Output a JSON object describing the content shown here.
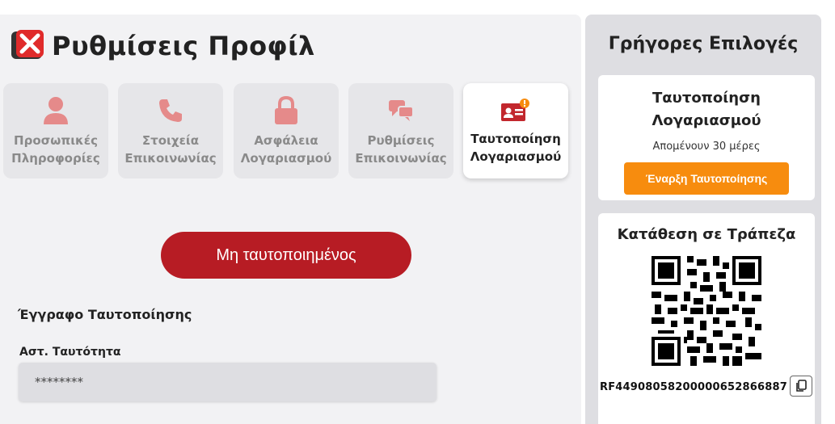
{
  "main": {
    "title": "Ρυθμίσεις Προφίλ",
    "tabs": [
      {
        "label": "Προσωπικές Πληροφορίες",
        "icon": "user-icon"
      },
      {
        "label": "Στοιχεία Επικοινωνίας",
        "icon": "phone-icon"
      },
      {
        "label": "Ασφάλεια Λογαριασμού",
        "icon": "lock-icon"
      },
      {
        "label": "Ρυθμίσεις Επικοινωνίας",
        "icon": "chat-icon"
      },
      {
        "label": "Ταυτοποίηση Λογαριασμού",
        "icon": "id-card-alert-icon",
        "active": true
      }
    ],
    "status_label": "Μη ταυτοποιημένος",
    "section_title": "Έγγραφο Ταυτοποίησης",
    "field_label": "Αστ. Ταυτότητα",
    "field_value": "********"
  },
  "side": {
    "title": "Γρήγορες Επιλογές",
    "verify_card": {
      "title": "Ταυτοποίηση Λογαριασμού",
      "subtitle": "Απομένουν 30 μέρες",
      "button_label": "Έναρξη Ταυτοποίησης"
    },
    "deposit_card": {
      "title": "Κατάθεση σε Τράπεζα",
      "reference": "RF4490805820000065286688​7"
    }
  },
  "colors": {
    "accent_red": "#b71c24",
    "tab_icon_red": "#e58a8a",
    "orange": "#f78c0e"
  }
}
